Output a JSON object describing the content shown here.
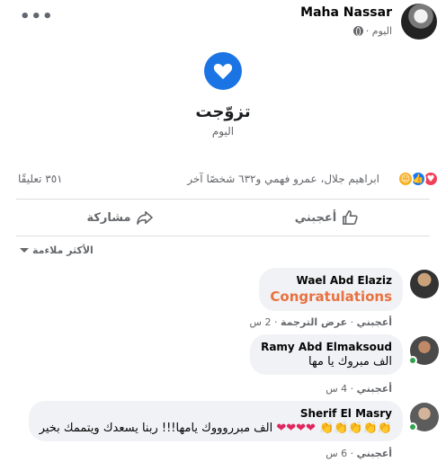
{
  "post": {
    "author": "Maha Nassar",
    "time": "اليوم · ",
    "privacy_icon": "globe-icon",
    "more": "•••"
  },
  "life_event": {
    "icon": "heart-icon",
    "title": "تزوّجت",
    "date": "اليوم"
  },
  "reactions": {
    "icons": [
      "love",
      "like",
      "care"
    ],
    "summary": "ابراهيم جلال، عمرو فهمي و٦٣٢ شخصًا آخر",
    "comments_count": "٣٥١ تعليقًا"
  },
  "actions": {
    "like": "أعجبني",
    "share": "مشاركة"
  },
  "sort": {
    "label": "الأكثر ملاءمة"
  },
  "comments": [
    {
      "name": "Wael Abd Elaziz",
      "text": "Congratulations",
      "like": "أعجبني",
      "translate": "عرض الترجمة",
      "time": "2 س"
    },
    {
      "name": "Ramy Abd Elmaksoud",
      "text": "الف مبروك يا مها",
      "like": "أعجبني",
      "time": "4 س"
    },
    {
      "name": "Sherif El Masry",
      "text": "الف مبرروووك يامها!!! ربنا يسعدك ويتممك بخير",
      "emoji_hearts": "❤❤❤❤",
      "emoji_claps": "👏👏👏👏👏",
      "like": "أعجبني",
      "time": "6 س"
    }
  ],
  "colors": {
    "accent": "#1b74e4",
    "congrats": "#e9713f",
    "bubble": "#f0f2f5",
    "online": "#31a24c"
  }
}
